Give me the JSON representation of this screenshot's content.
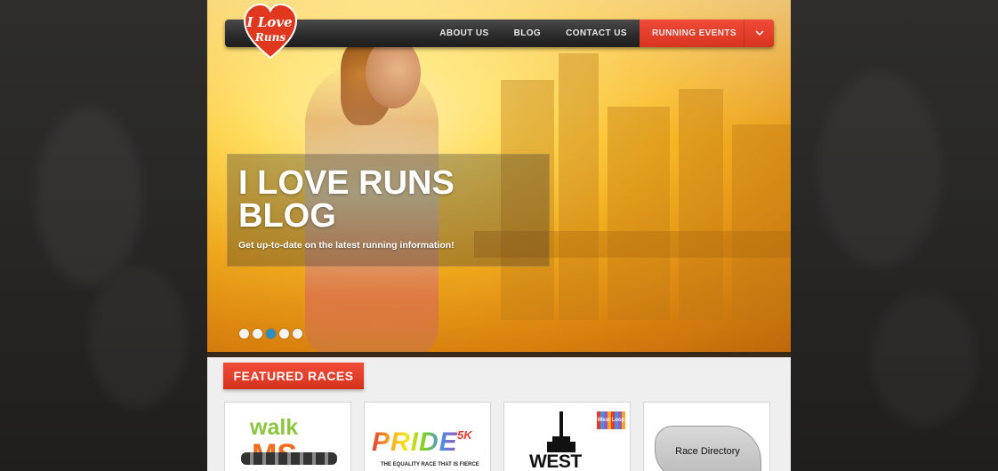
{
  "brand": {
    "logo_text_top": "I Love",
    "logo_text_bottom": "Runs",
    "accent": "#e0381f",
    "nav_dark": "#2c2c2c"
  },
  "nav": {
    "items": [
      {
        "label": "ABOUT US"
      },
      {
        "label": "BLOG"
      },
      {
        "label": "CONTACT US"
      }
    ],
    "events_label": "RUNNING EVENTS",
    "events_icon": "chevron-down-icon"
  },
  "hero": {
    "title": "I LOVE RUNS BLOG",
    "subtitle": "Get up-to-date on the latest running information!",
    "slides_count": 5,
    "active_slide": 3
  },
  "featured": {
    "heading": "FEATURED RACES",
    "cards": [
      {
        "name": "walk-ms",
        "line1": "walk",
        "line2": "MS"
      },
      {
        "name": "pride-5k",
        "line1": "PRIDE",
        "line2": "5K",
        "tagline": "THE EQUALITY RACE THAT IS FIERCE"
      },
      {
        "name": "west-loop",
        "line1": "WEST LOOP",
        "badge": "West Loop"
      },
      {
        "name": "race-directory",
        "line1": "RACE DIRECTORY"
      }
    ]
  }
}
